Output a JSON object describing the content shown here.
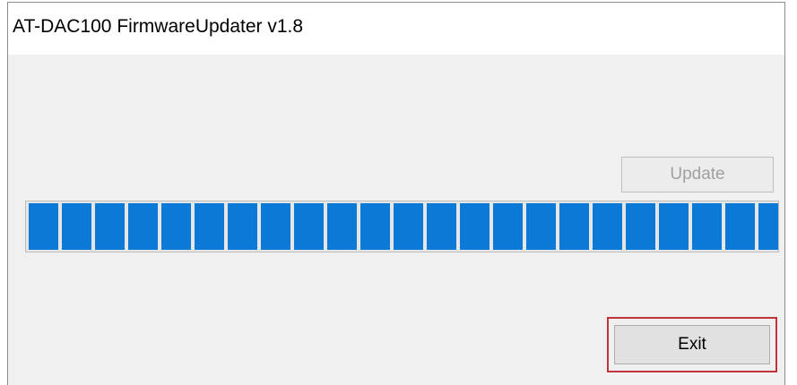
{
  "window": {
    "title": "AT-DAC100 FirmwareUpdater v1.8"
  },
  "buttons": {
    "update_label": "Update",
    "exit_label": "Exit"
  },
  "progress": {
    "fraction": 1.0,
    "color": "#0a7ad6"
  },
  "highlight": {
    "color": "#c0343b"
  }
}
